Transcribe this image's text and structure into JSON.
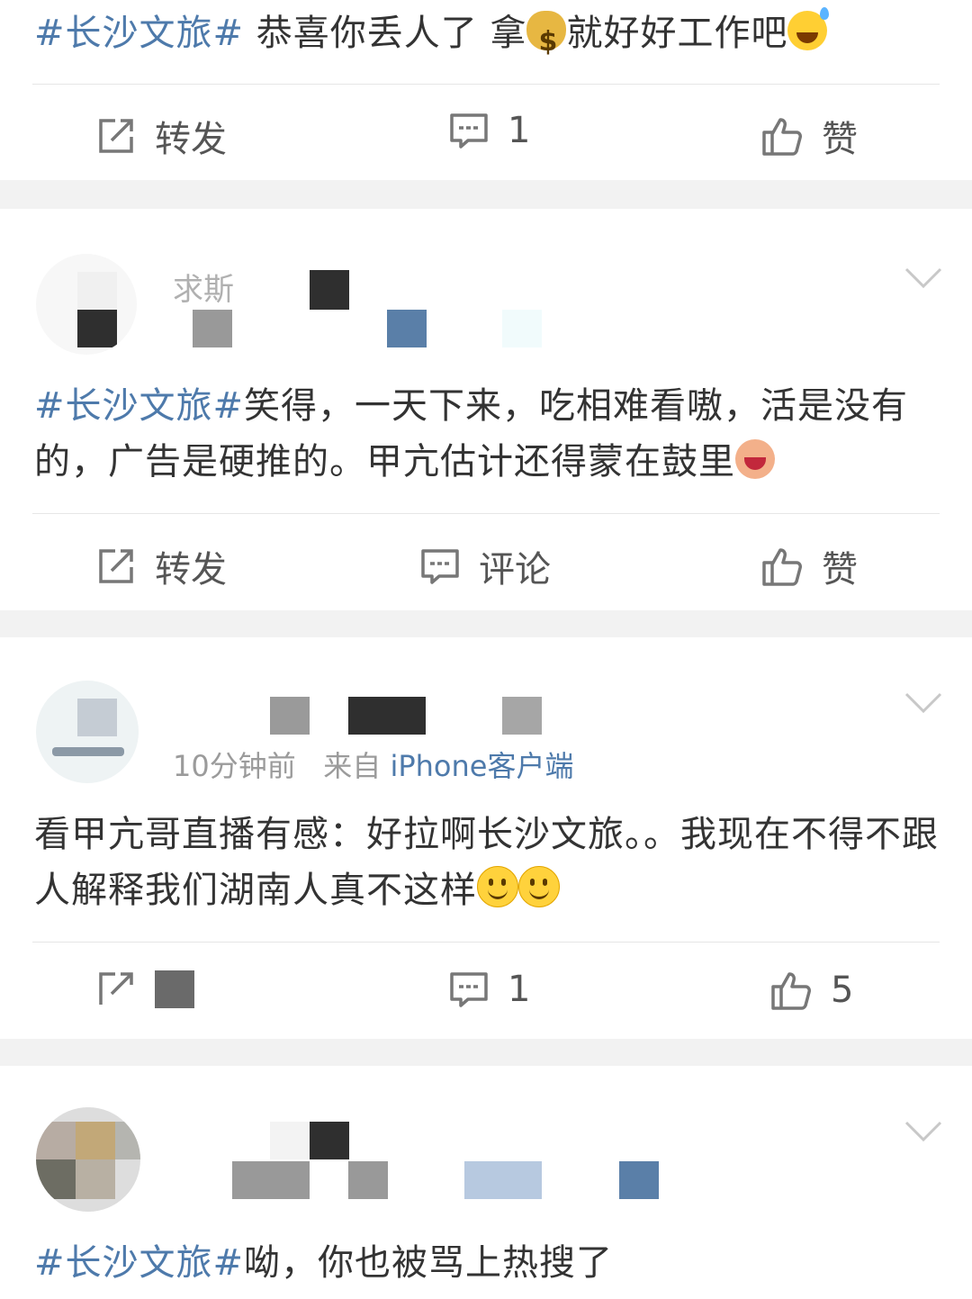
{
  "posts": [
    {
      "hashtag": "#长沙文旅#",
      "text": " 恭喜你丢人了 拿",
      "emoji_1": "money-bag",
      "text_2": "就好好工作吧",
      "emoji_2": "sweat-smile",
      "actions": {
        "repost": "转发",
        "comment": "1",
        "like": "赞"
      }
    },
    {
      "user": {
        "name": "求斯",
        "avatar": "avatar-blurred"
      },
      "hashtag": "#长沙文旅#",
      "text": "笑得，一天下来，吃相难看嗷，活是没有的，广告是硬推的。甲亢估计还得蒙在鼓里",
      "emoji": "laughing-doll",
      "actions": {
        "repost": "转发",
        "comment": "评论",
        "like": "赞"
      }
    },
    {
      "user": {
        "avatar": "avatar-blurred"
      },
      "time": "10分钟前",
      "from_label": "来自",
      "source": "iPhone客户端",
      "text": "看甲亢哥直播有感：好拉啊长沙文旅。。我现在不得不跟人解释我们湖南人真不这样",
      "emoji": "smile",
      "actions": {
        "comment": "1",
        "like": "5"
      }
    },
    {
      "user": {
        "avatar": "avatar-blurred"
      },
      "hashtag": "#长沙文旅#",
      "text": "呦，你也被骂上热搜了"
    }
  ],
  "icons": {
    "repost": "repost-icon",
    "comment": "comment-icon",
    "like": "thumbs-up-icon",
    "menu": "chevron-down-icon"
  },
  "colors": {
    "hashtag": "#4e7aab",
    "background_gap": "#f2f2f2",
    "text": "#333333"
  }
}
